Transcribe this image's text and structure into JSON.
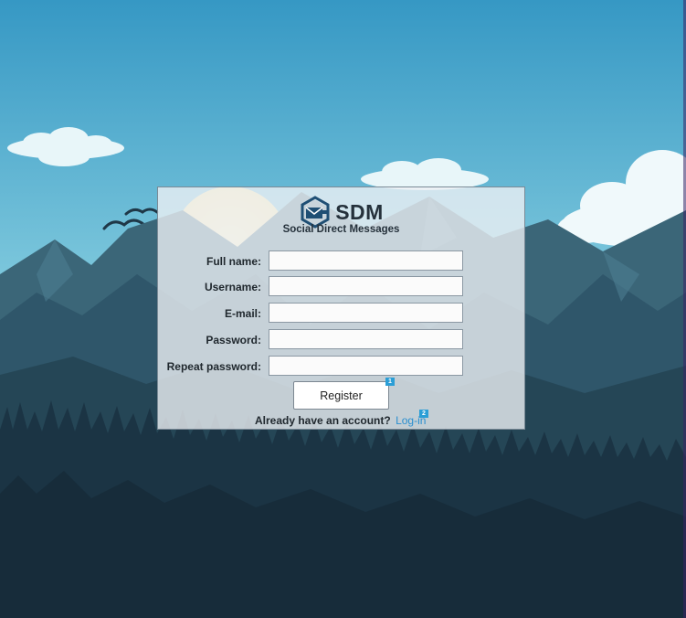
{
  "app": {
    "logo_name": "SDM",
    "subtitle": "Social Direct Messages"
  },
  "form": {
    "fields": [
      {
        "label": "Full name:",
        "value": ""
      },
      {
        "label": "Username:",
        "value": ""
      },
      {
        "label": "E-mail:",
        "value": ""
      },
      {
        "label": "Password:",
        "value": ""
      },
      {
        "label": "Repeat password:",
        "value": ""
      }
    ],
    "register_label": "Register",
    "register_hint": "1",
    "footer_text": "Already have an account?",
    "login_label": "Log-in",
    "login_hint": "2"
  },
  "colors": {
    "sky_top": "#3aa0c8",
    "sky_bottom": "#b6e6ee",
    "mountain_dark": "#1d3445",
    "accent_link": "#2a8fd0",
    "hint_badge": "#2b9ed6"
  },
  "icons": {
    "logo": "envelope-hexagon-icon"
  }
}
